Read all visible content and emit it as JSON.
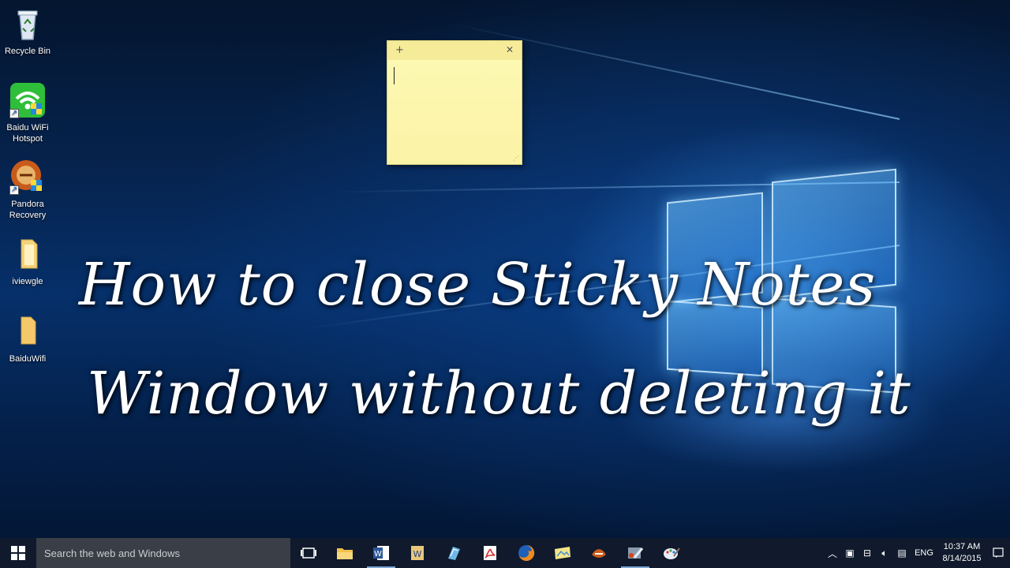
{
  "desktop": {
    "icons": [
      {
        "name": "recycle-bin",
        "label": "Recycle Bin",
        "icon": "recycle-bin-icon"
      },
      {
        "name": "baidu-wifi-hotspot",
        "label": "Baidu WiFi Hotspot",
        "icon": "wifi-icon"
      },
      {
        "name": "pandora-recovery",
        "label": "Pandora Recovery",
        "icon": "pandora-icon"
      },
      {
        "name": "iviewgle",
        "label": "iviewgle",
        "icon": "folder-icon"
      },
      {
        "name": "baiduwifi",
        "label": "BaiduWifi",
        "icon": "folder-icon"
      }
    ]
  },
  "sticky_note": {
    "add_symbol": "+",
    "close_symbol": "✕",
    "text": ""
  },
  "headline": {
    "line1": "How to close Sticky Notes",
    "line2": "Window without deleting it"
  },
  "taskbar": {
    "search_placeholder": "Search the web and Windows",
    "apps": [
      "task-view",
      "file-explorer",
      "word",
      "wordpad",
      "app-blue",
      "acrobat",
      "firefox",
      "photos",
      "pandora",
      "app-tool",
      "paint"
    ],
    "tray": {
      "language": "ENG",
      "time": "10:37 AM",
      "date": "8/14/2015"
    }
  },
  "colors": {
    "wallpaper": "#06306a",
    "taskbar": "#101a2c",
    "search_box": "#3a3f47",
    "sticky": "#fbf3a6"
  }
}
